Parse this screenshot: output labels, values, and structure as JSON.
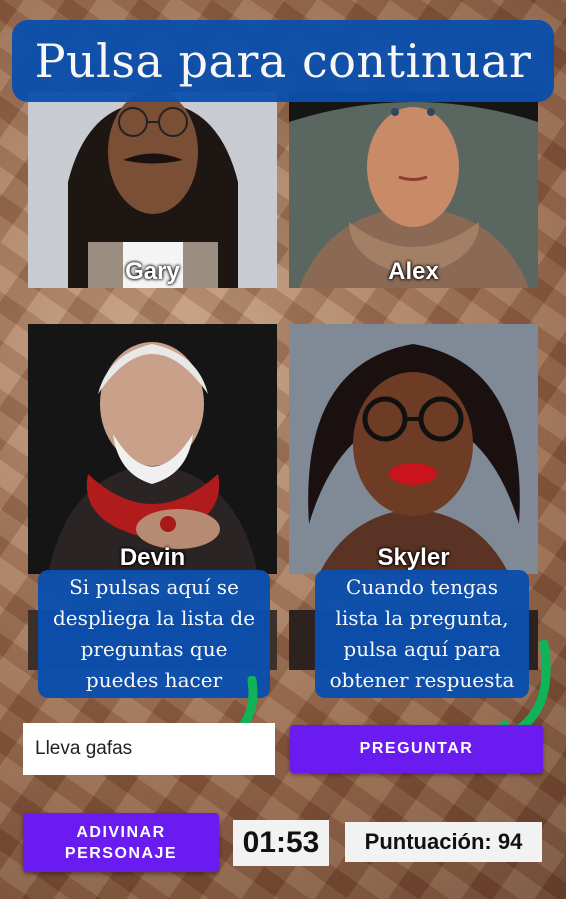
{
  "banner": {
    "title": "Pulsa para continuar"
  },
  "cards": [
    {
      "name": "Gary"
    },
    {
      "name": "Alex"
    },
    {
      "name": "Devin"
    },
    {
      "name": "Skyler"
    }
  ],
  "hints": {
    "left": [
      "Si pulsas aquí se",
      "despliega la lista de",
      "preguntas que",
      "puedes hacer"
    ],
    "right": [
      "Cuando tengas",
      "lista la pregunta,",
      "pulsa aquí para",
      "obtener respuesta"
    ]
  },
  "question_select": {
    "value": "Lleva gafas"
  },
  "buttons": {
    "ask": "PREGUNTAR",
    "guess_line1": "ADIVINAR",
    "guess_line2": "PERSONAJE"
  },
  "timer": "01:53",
  "score": "Puntuación: 94",
  "colors": {
    "banner": "#0a4fae",
    "button": "#6a1bef",
    "arrow": "#10b35a"
  }
}
